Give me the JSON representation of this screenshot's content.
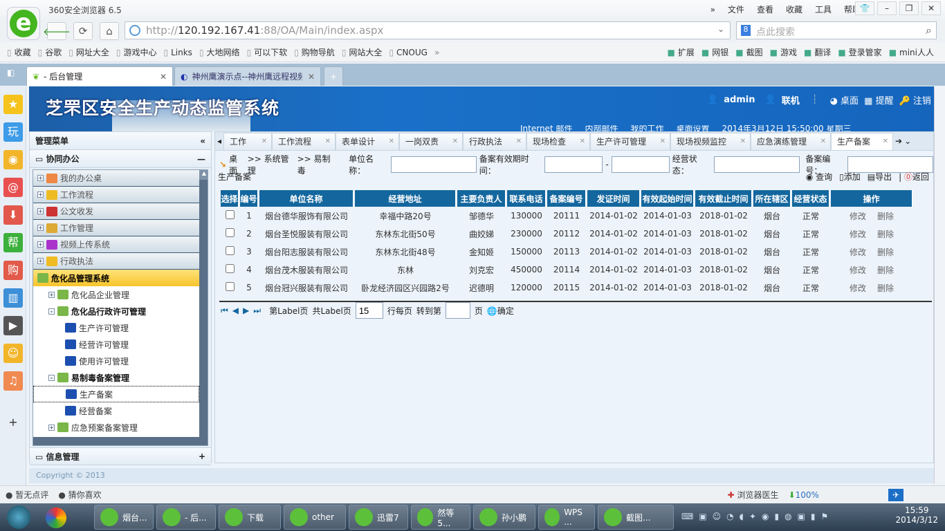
{
  "browser": {
    "title": "360安全浏览器 6.5",
    "menus": [
      "文件",
      "查看",
      "收藏",
      "工具",
      "帮助"
    ],
    "url_prefix": "http://",
    "url_host": "120.192.167.41",
    "url_rest": ":88/OA/Main/index.aspx",
    "search_placeholder": "点此搜索",
    "bookmarks": [
      "收藏",
      "谷歌",
      "网址大全",
      "游戏中心",
      "Links",
      "大地网络",
      "可以下软",
      "购物导航",
      "网站大全",
      "CNOUG"
    ],
    "extensions": [
      "扩展",
      "网银",
      "截图",
      "游戏",
      "翻译",
      "登录管家",
      "mini人人"
    ],
    "tabs": [
      {
        "label": "- 后台管理",
        "active": true
      },
      {
        "label": "神州鹰演示点--神州鹰远程视频",
        "active": false
      }
    ],
    "sidebar_icons": [
      "star-icon",
      "play-icon",
      "weibo-icon",
      "mail-icon",
      "download-icon",
      "help-icon",
      "shop-icon",
      "book-icon",
      "video-icon",
      "game-icon",
      "music-icon"
    ]
  },
  "app": {
    "title": "芝罘区安全生产动态监管系统",
    "user": "admin",
    "status": "联机",
    "header_links": [
      "桌面",
      "提醒",
      "注销"
    ],
    "quick_links": [
      "Internet 邮件",
      "内部邮件",
      "我的工作",
      "桌面设置",
      "2014年3月12日 15:50:00 星期三"
    ],
    "copyright": "Copyright © 2013"
  },
  "menu": {
    "title": "管理菜单",
    "group1": "协同办公",
    "group2": "信息管理",
    "top_items": [
      "我的办公桌",
      "工作流程",
      "公文收发",
      "工作管理",
      "视频上传系统",
      "行政执法"
    ],
    "tree": [
      {
        "label": "危化品管理系统",
        "level": 0,
        "selected": true
      },
      {
        "label": "危化品企业管理",
        "level": 1,
        "exp": "+"
      },
      {
        "label": "危化品行政许可管理",
        "level": 1,
        "exp": "-",
        "bold": true
      },
      {
        "label": "生产许可管理",
        "level": 2
      },
      {
        "label": "经营许可管理",
        "level": 2
      },
      {
        "label": "使用许可管理",
        "level": 2
      },
      {
        "label": "易制毒备案管理",
        "level": 1,
        "exp": "-",
        "bold": true
      },
      {
        "label": "生产备案",
        "level": 2,
        "focus": true
      },
      {
        "label": "经营备案",
        "level": 2
      },
      {
        "label": "应急预案备案管理",
        "level": 1,
        "exp": "+"
      }
    ]
  },
  "page_tabs": [
    "工作",
    "工作流程",
    "表单设计",
    "一岗双责",
    "行政执法",
    "现场检查",
    "生产许可管理",
    "现场视频监控",
    "应急演练管理",
    "生产备案"
  ],
  "breadcrumb": [
    "桌面",
    ">> 系统管理",
    ">> 易制毒",
    "生产备案"
  ],
  "filters": {
    "unit_label": "单位名称：",
    "period_label": "备案有效期时间：",
    "status_label": "经营状态：",
    "code_label": "备案编号："
  },
  "toolbar": [
    "查询",
    "添加",
    "导出",
    "返回"
  ],
  "table": {
    "headers": [
      "选择",
      "编号",
      "单位名称",
      "经营地址",
      "主要负责人",
      "联系电话",
      "备案编号",
      "发证时间",
      "有效起始时间",
      "有效截止时间",
      "所在辖区",
      "经营状态",
      "操作"
    ],
    "rows": [
      [
        "1",
        "烟台德华服饰有限公司",
        "幸福中路20号",
        "邹德华",
        "130000",
        "20111",
        "2014-01-02",
        "2014-01-03",
        "2018-01-02",
        "烟台",
        "正常"
      ],
      [
        "2",
        "烟台圣悦服装有限公司",
        "东林东北街50号",
        "曲姣娣",
        "230000",
        "20112",
        "2014-01-02",
        "2014-01-03",
        "2018-01-02",
        "烟台",
        "正常"
      ],
      [
        "3",
        "烟台阳志服装有限公司",
        "东林东北街48号",
        "金知姬",
        "150000",
        "20113",
        "2014-01-02",
        "2014-01-03",
        "2018-01-02",
        "烟台",
        "正常"
      ],
      [
        "4",
        "烟台茂木服装有限公司",
        "东林",
        "刘克宏",
        "450000",
        "20114",
        "2014-01-02",
        "2014-01-03",
        "2018-01-02",
        "烟台",
        "正常"
      ],
      [
        "5",
        "烟台冠兴服装有限公司",
        "卧龙经济园区兴园路2号",
        "迟德明",
        "120000",
        "20115",
        "2014-01-02",
        "2014-01-03",
        "2018-01-02",
        "烟台",
        "正常"
      ]
    ],
    "ops": [
      "修改",
      "删除"
    ]
  },
  "pager": {
    "current": "第Label页",
    "total": "共Label页",
    "page_size": "15",
    "per_page": "行每页",
    "goto": "转到第",
    "page": "页",
    "ok": "确定"
  },
  "statusbar": {
    "left": [
      "暂无点评",
      "猜你喜欢"
    ],
    "doctor": "浏览器医生",
    "zoom": "100%"
  },
  "taskbar": {
    "items": [
      "烟台...",
      "- 后...",
      "下载",
      "other",
      "迅雷7",
      "然等5...",
      "孙小鹏",
      "WPS ...",
      "截图..."
    ],
    "time": "15:59",
    "date": "2014/3/12"
  }
}
